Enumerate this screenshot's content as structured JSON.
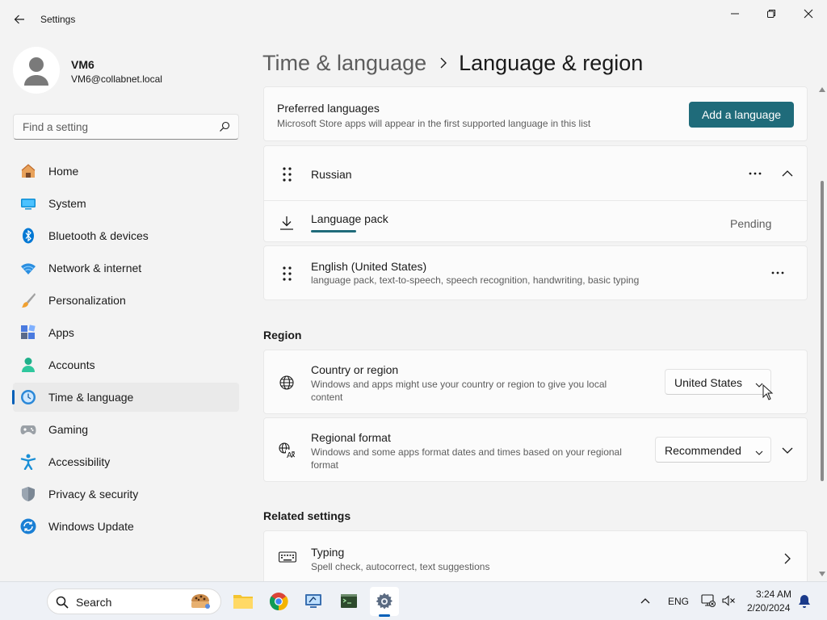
{
  "window": {
    "title": "Settings"
  },
  "profile": {
    "name": "VM6",
    "email": "VM6@collabnet.local"
  },
  "search": {
    "placeholder": "Find a setting"
  },
  "nav": {
    "items": [
      {
        "label": "Home",
        "icon": "home-icon"
      },
      {
        "label": "System",
        "icon": "system-icon"
      },
      {
        "label": "Bluetooth & devices",
        "icon": "bluetooth-icon"
      },
      {
        "label": "Network & internet",
        "icon": "wifi-icon"
      },
      {
        "label": "Personalization",
        "icon": "brush-icon"
      },
      {
        "label": "Apps",
        "icon": "apps-icon"
      },
      {
        "label": "Accounts",
        "icon": "accounts-icon"
      },
      {
        "label": "Time & language",
        "icon": "time-language-icon",
        "active": true
      },
      {
        "label": "Gaming",
        "icon": "gamepad-icon"
      },
      {
        "label": "Accessibility",
        "icon": "accessibility-icon"
      },
      {
        "label": "Privacy & security",
        "icon": "shield-icon"
      },
      {
        "label": "Windows Update",
        "icon": "update-icon"
      }
    ]
  },
  "breadcrumb": {
    "parent": "Time & language",
    "current": "Language & region"
  },
  "preferred": {
    "title": "Preferred languages",
    "subtitle": "Microsoft Store apps will appear in the first supported language in this list",
    "add_button": "Add a language"
  },
  "languages": [
    {
      "name": "Russian",
      "expanded": true
    },
    {
      "name": "English (United States)",
      "details": "language pack, text-to-speech, speech recognition, handwriting, basic typing"
    }
  ],
  "language_pack": {
    "label": "Language pack",
    "status": "Pending"
  },
  "region": {
    "title": "Region",
    "country": {
      "title": "Country or region",
      "desc_line1": "Windows and apps might use your country or region to give you local",
      "desc_line2": "content",
      "value": "United States"
    },
    "format": {
      "title": "Regional format",
      "desc_line1": "Windows and some apps format dates and times based on your regional",
      "desc_line2": "format",
      "value": "Recommended"
    }
  },
  "related": {
    "title": "Related settings",
    "typing": {
      "title": "Typing",
      "desc": "Spell check, autocorrect, text suggestions"
    }
  },
  "taskbar": {
    "search_label": "Search",
    "apps": [
      "file-explorer-icon",
      "chrome-icon",
      "remote-desktop-icon",
      "terminal-icon",
      "settings-icon"
    ],
    "language": "ENG",
    "time": "3:24 AM",
    "date": "2/20/2024"
  },
  "colors": {
    "accent": "#1f6b7a",
    "nav_indicator": "#005fb8"
  }
}
